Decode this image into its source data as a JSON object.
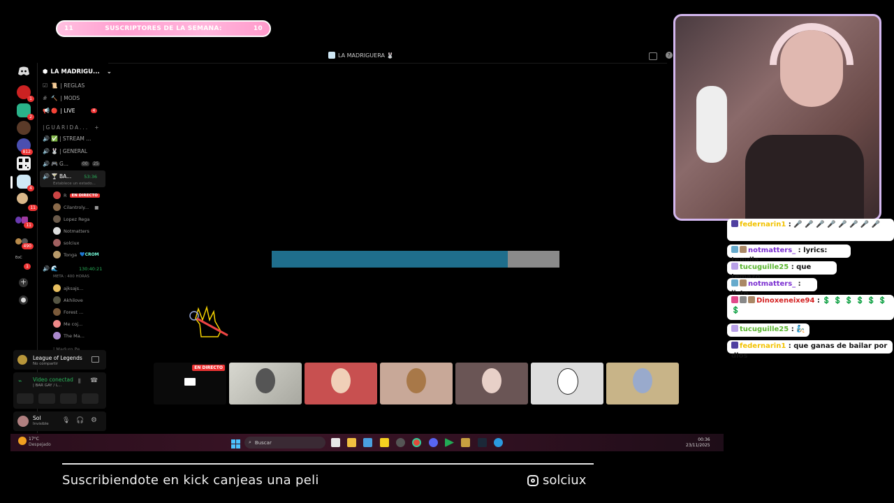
{
  "banner": {
    "left_num": "11",
    "title": "SUSCRIPTORES DE LA SEMANA:",
    "right_num": "10"
  },
  "window": {
    "title": "LA MADRIGUERA 🐰"
  },
  "server": {
    "name": "LA MADRIGU..."
  },
  "channels": [
    {
      "icon": "📜",
      "label": "| REGLAS"
    },
    {
      "icon": "🔨",
      "label": "| MODS"
    },
    {
      "icon": "🔴",
      "label": "| LIVE",
      "badge": "4"
    }
  ],
  "category": "|GUARIDA...",
  "voice_channels": [
    {
      "label": "| STREAM ..."
    },
    {
      "label": "| GENERAL"
    },
    {
      "label": "G...",
      "badge_a": "00",
      "badge_b": "25"
    },
    {
      "label": "BA...",
      "time": "53:36",
      "status": "Establece un estado..."
    }
  ],
  "users": [
    "R",
    "Cilantroly...",
    "Lopez Rega",
    "Notmatters",
    "solciux",
    "Tonga"
  ],
  "live_badge": "EN DIRECTO",
  "tonga_tag": "CROM",
  "voice2": {
    "time": "130:40:21",
    "meta": "META : 400 HORAS"
  },
  "users2": [
    "ajksajs...",
    "Akhilove",
    "Forest ...",
    "Me coj...",
    "The Ma...",
    "| Maduro Pe..."
  ],
  "activity": {
    "title": "League of Legends",
    "sub": "No compartir"
  },
  "video": {
    "title": "Video conectad",
    "sub": "| BAR GAY / L..."
  },
  "me": {
    "name": "Sol",
    "status": "Invisible"
  },
  "server_badges": [
    "1",
    "2",
    "812",
    "4",
    "11",
    "11",
    "490",
    "1"
  ],
  "tile_live": "EN DIRECTO",
  "progress": 0.82,
  "taskbar": {
    "weather_temp": "17°C",
    "weather_desc": "Despejado",
    "search": "Buscar",
    "time": "00:36",
    "date": "23/11/2025"
  },
  "chat": [
    {
      "name": "federnarin1",
      "text": ": 🎤 🎤 🎤 🎤 🎤 🎤 🎤 🎤",
      "color": "#f2c200"
    },
    {
      "name": "notmatters_",
      "text": ": lyrics: tequila",
      "color": "#7b2fd1"
    },
    {
      "name": "tucuguille25",
      "text": ": que temazo",
      "color": "#5ab530"
    },
    {
      "name": "notmatters_",
      "text": ": listo",
      "color": "#7b2fd1"
    },
    {
      "name": "Dinoxeneixe94",
      "text": ": 💲 💲 💲 💲 💲 💲 💲",
      "color": "#d42020"
    },
    {
      "name": "tucuguille25",
      "text": ": 🧞",
      "color": "#5ab530"
    },
    {
      "name": "federnarin1",
      "text": ": que ganas de bailar por dios",
      "color": "#f2c200"
    }
  ],
  "footer": {
    "left": "Suscribiendote en kick canjeas una peli",
    "handle": "solciux"
  }
}
